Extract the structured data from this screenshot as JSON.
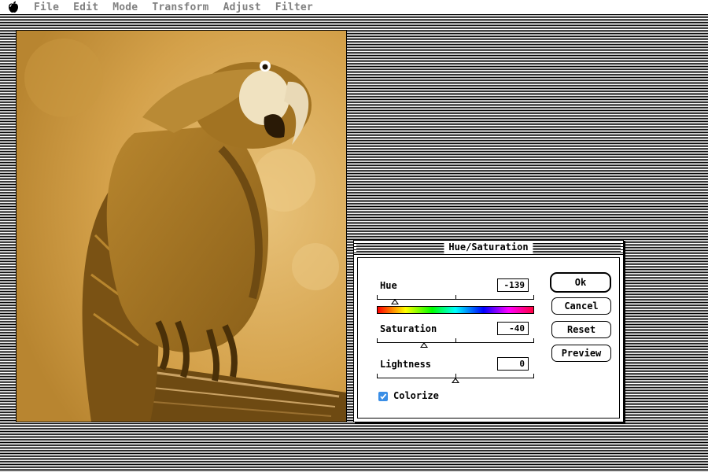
{
  "menubar": {
    "apple_icon": "apple-icon",
    "items": [
      "File",
      "Edit",
      "Mode",
      "Transform",
      "Adjust",
      "Filter"
    ]
  },
  "image": {
    "subject": "sepia-toned parrot photograph",
    "tint_color": "#d7a64a"
  },
  "dialog": {
    "title": "Hue/Saturation",
    "hue": {
      "label": "Hue",
      "value": "-139",
      "range": [
        -180,
        180
      ]
    },
    "saturation": {
      "label": "Saturation",
      "value": "-40",
      "range": [
        -100,
        100
      ]
    },
    "lightness": {
      "label": "Lightness",
      "value": "0",
      "range": [
        -100,
        100
      ]
    },
    "colorize": {
      "label": "Colorize",
      "checked": true,
      "color": "#3a8ee6"
    },
    "buttons": {
      "ok": "Ok",
      "cancel": "Cancel",
      "reset": "Reset",
      "preview": "Preview"
    }
  }
}
